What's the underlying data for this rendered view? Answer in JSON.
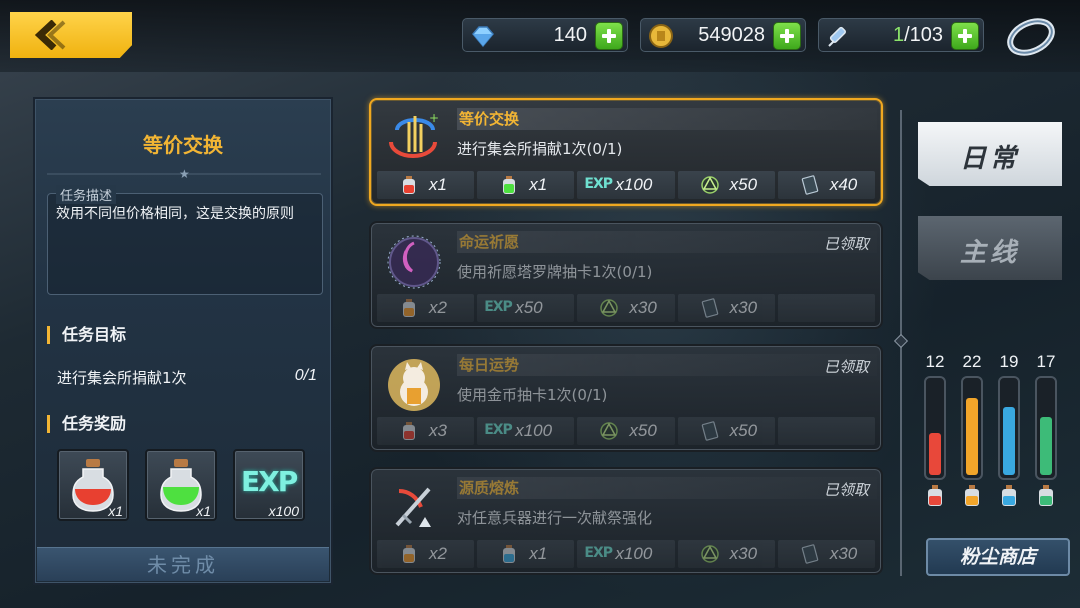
{
  "resources": {
    "gems": "140",
    "coins": "549028",
    "stamina_current": "1",
    "stamina_max": "/103"
  },
  "left_panel": {
    "title": "等价交换",
    "desc_label": "任务描述",
    "desc_text": "效用不同但价格相同，这是交换的原则",
    "goal_heading": "任务目标",
    "goal_text": "进行集会所捐献1次",
    "goal_progress": "0/1",
    "reward_heading": "任务奖励",
    "rewards": [
      {
        "icon": "red-potion-icon",
        "qty": "x1"
      },
      {
        "icon": "green-potion-icon",
        "qty": "x1"
      },
      {
        "icon": "exp-icon",
        "label": "EXP",
        "qty": "x100"
      }
    ],
    "status_button": "未完成"
  },
  "tasks": [
    {
      "title": "等价交换",
      "desc": "进行集会所捐献1次(0/1)",
      "status": "",
      "rewards": [
        {
          "icon": "red-potion-icon",
          "qty": "x1"
        },
        {
          "icon": "green-potion-icon",
          "qty": "x1"
        },
        {
          "icon": "exp-icon",
          "label": "EXP",
          "qty": "x100"
        },
        {
          "icon": "rune-icon",
          "qty": "x50"
        },
        {
          "icon": "dust-card-icon",
          "qty": "x40"
        }
      ]
    },
    {
      "title": "命运祈愿",
      "desc": "使用祈愿塔罗牌抽卡1次(0/1)",
      "status": "已领取",
      "rewards": [
        {
          "icon": "orange-potion-icon",
          "qty": "x2"
        },
        {
          "icon": "exp-icon",
          "label": "EXP",
          "qty": "x50"
        },
        {
          "icon": "rune-icon",
          "qty": "x30"
        },
        {
          "icon": "dust-card-icon",
          "qty": "x30"
        }
      ]
    },
    {
      "title": "每日运势",
      "desc": "使用金币抽卡1次(0/1)",
      "status": "已领取",
      "rewards": [
        {
          "icon": "red-potion-icon",
          "qty": "x3"
        },
        {
          "icon": "exp-icon",
          "label": "EXP",
          "qty": "x100"
        },
        {
          "icon": "rune-icon",
          "qty": "x50"
        },
        {
          "icon": "dust-card-icon",
          "qty": "x50"
        }
      ]
    },
    {
      "title": "源质熔炼",
      "desc": "对任意兵器进行一次献祭强化",
      "status": "已领取",
      "rewards": [
        {
          "icon": "orange-potion-icon",
          "qty": "x2"
        },
        {
          "icon": "blue-potion-icon",
          "qty": "x1"
        },
        {
          "icon": "exp-icon",
          "label": "EXP",
          "qty": "x100"
        },
        {
          "icon": "rune-icon",
          "qty": "x30"
        },
        {
          "icon": "dust-card-icon",
          "qty": "x30"
        }
      ]
    }
  ],
  "tabs": {
    "daily": "日常",
    "main": "主线"
  },
  "meters": [
    {
      "value": "12",
      "fraction": 0.45,
      "color": "#e8483a"
    },
    {
      "value": "22",
      "fraction": 0.82,
      "color": "#f2a52a"
    },
    {
      "value": "19",
      "fraction": 0.72,
      "color": "#39a8e0"
    },
    {
      "value": "17",
      "fraction": 0.62,
      "color": "#3dbb78"
    }
  ],
  "shop_button": "粉尘商店"
}
